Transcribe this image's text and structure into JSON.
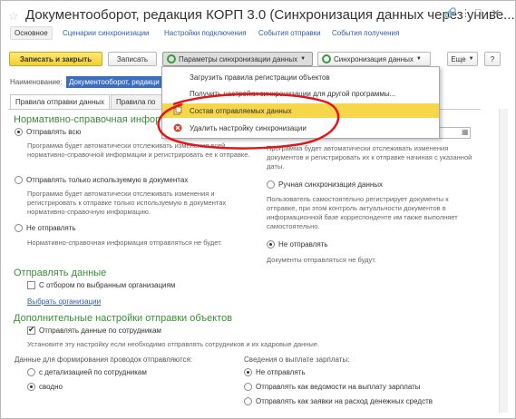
{
  "window": {
    "title": "Документооборот, редакция КОРП 3.0 (Синхронизация данных через униве...",
    "star_icon": "star-icon",
    "link_icon": "link-icon",
    "more_icon": "more-icon",
    "maximize_icon": "maximize-icon",
    "close_icon": "close-icon"
  },
  "nav": {
    "tabs": [
      "Основное",
      "Сценарии синхронизации",
      "Настройки подключения",
      "События отправки",
      "События получения"
    ]
  },
  "toolbar": {
    "save_close": "Записать и закрыть",
    "save": "Записать",
    "sync_params": "Параметры синхронизации данных",
    "sync_data": "Синхронизация данных",
    "more": "Еще",
    "help": "?"
  },
  "name_field": {
    "label": "Наименование:",
    "value": "Документооборот, редакци"
  },
  "tabs": {
    "rules": "Правила отправки данных",
    "second": "Правила по"
  },
  "menu": {
    "items": [
      "Загрузить правила регистрации объектов",
      "Получить настройки синхронизации для другой программы...",
      "Состав отправляемых данных",
      "Удалить настройку синхронизации"
    ]
  },
  "left": {
    "nsi_header": "Нормативно-справочная информа",
    "send_all": "Отправлять всю",
    "send_all_desc": "Программа будет автоматически отслеживать изменения всей нормативно-справочной информации и регистрировать ее к отправке.",
    "send_used": "Отправлять только используемую в документах",
    "send_used_desc": "Программа будет автоматически отслеживать изменения и регистрировать к отправке только используемую в документах нормативно-справочную информацию.",
    "no_send": "Не отправлять",
    "no_send_desc": "Нормативно-справочная информация отправляться не будет.",
    "send_data_header": "Отправлять данные",
    "by_orgs": "С отбором по выбранным организациям",
    "choose_orgs": "Выбрать организации"
  },
  "right": {
    "desc1": "Программа будет автоматически отслеживать изменения документов и регистрировать их к отправке начиная с указанной даты.",
    "manual": "Ручная синхронизация данных",
    "manual_desc": "Пользователь самостоятельно регистрирует документы к отправке, при этом контроль актуальности документов в информационной базе корреспонденте им также выполняет самостоятельно.",
    "no_send": "Не отправлять",
    "no_send_desc": "Документы отправляться не будут."
  },
  "extra": {
    "header": "Дополнительные настройки отправки объектов",
    "send_employees": "Отправлять данные по сотрудникам",
    "send_employees_desc": "Установите эту настройку если необходимо отправлять сотрудников и их кадровые данные.",
    "postings_label": "Данные для формирования проводок отправляются:",
    "detail": "с детализацией по сотрудникам",
    "summary": "сводно",
    "salary_label": "Сведения о выплате зарплаты:",
    "salary_no": "Не отправлять",
    "salary_stmt": "Отправлять как ведомости на выплату зарплаты",
    "salary_req": "Отправлять как заявки на расход денежных средств"
  }
}
